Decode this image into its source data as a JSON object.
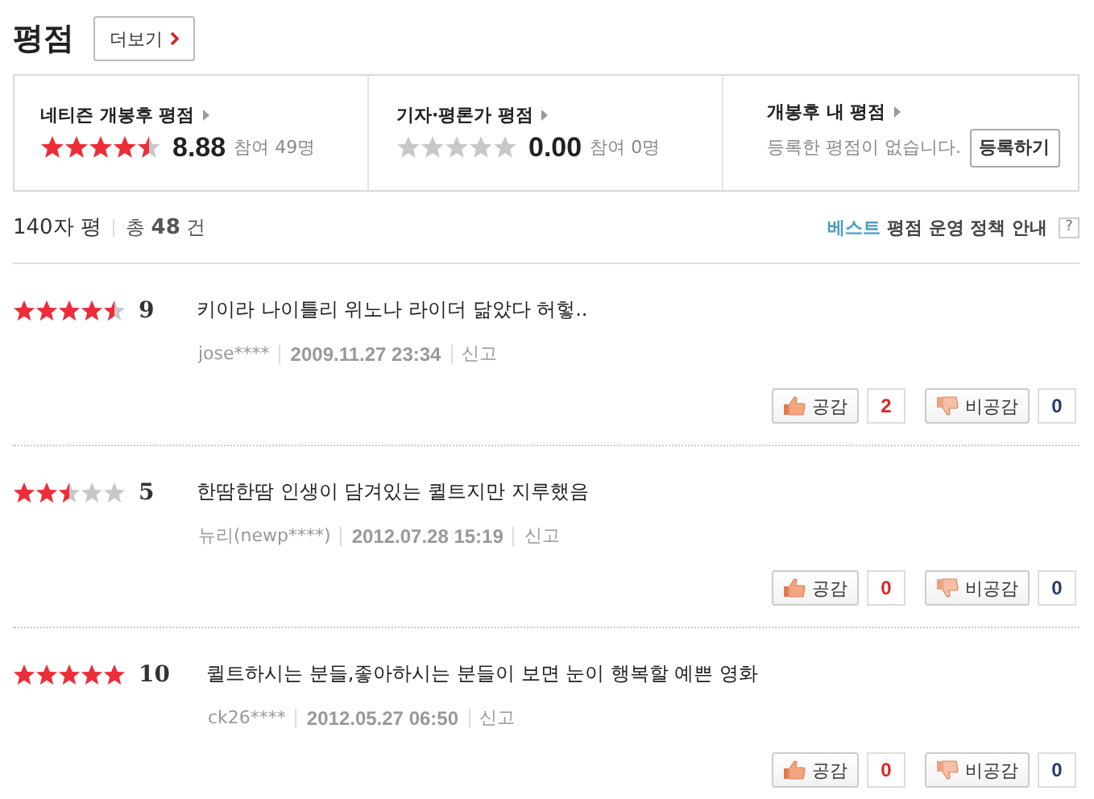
{
  "header": {
    "title": "평점",
    "more_button": "더보기"
  },
  "summary": [
    {
      "kind": "score",
      "label": "네티즌 개봉후 평점",
      "stars": 4.5,
      "score": "8.88",
      "participants": "참여 49명"
    },
    {
      "kind": "score",
      "label": "기자·평론가 평점",
      "stars": 0,
      "score": "0.00",
      "participants": "참여 0명"
    },
    {
      "kind": "mine",
      "label": "개봉후 내 평점",
      "message": "등록한 평점이 없습니다.",
      "button": "등록하기"
    }
  ],
  "list_header": {
    "title": "140자 평",
    "total_prefix": "총",
    "total": "48",
    "total_suffix": "건",
    "policy_highlight": "베스트",
    "policy": "평점 운영 정책 안내",
    "help": "?"
  },
  "reviews": [
    {
      "stars": 4.5,
      "score": "9",
      "text": "키이라 나이틀리 위노나 라이더 닮았다 허헣..",
      "author": "jose****",
      "date": "2009.11.27 23:34",
      "report": "신고",
      "like_label": "공감",
      "likes": "2",
      "dislike_label": "비공감",
      "dislikes": "0"
    },
    {
      "stars": 2.5,
      "score": "5",
      "text": "한땀한땀 인생이 담겨있는 퀼트지만 지루했음",
      "author": "뉴리(newp****)",
      "date": "2012.07.28 15:19",
      "report": "신고",
      "like_label": "공감",
      "likes": "0",
      "dislike_label": "비공감",
      "dislikes": "0"
    },
    {
      "stars": 5,
      "score": "10",
      "text": "퀼트하시는 분들,좋아하시는 분들이 보면 눈이 행복할 예쁜 영화",
      "author": "ck26****",
      "date": "2012.05.27 06:50",
      "report": "신고",
      "like_label": "공감",
      "likes": "0",
      "dislike_label": "비공감",
      "dislikes": "0"
    }
  ]
}
